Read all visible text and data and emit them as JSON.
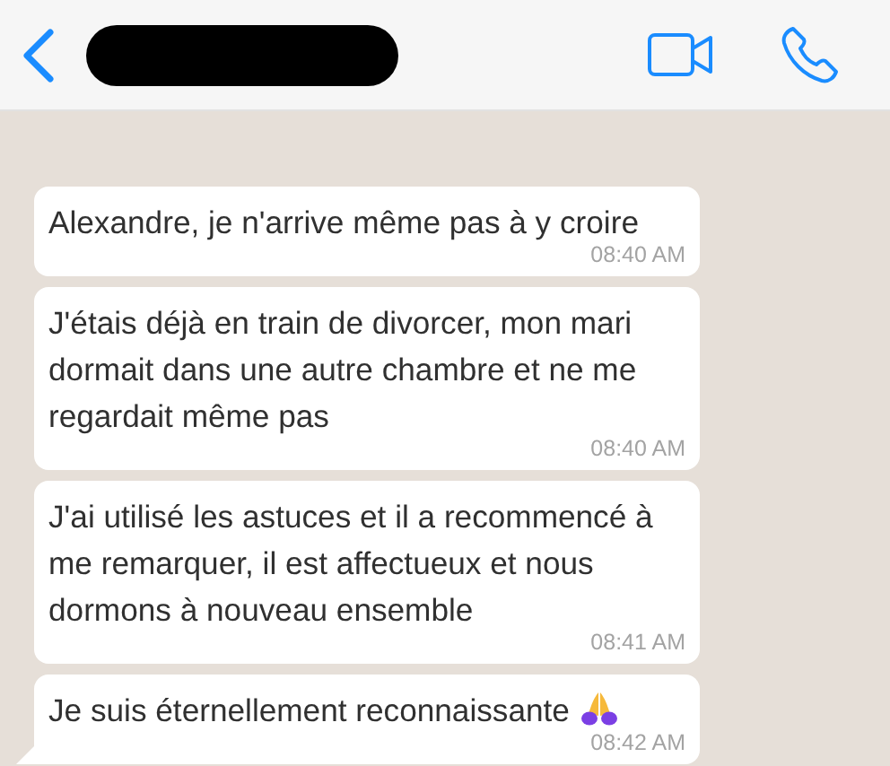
{
  "messages": [
    {
      "text": "Alexandre, je n'arrive même pas à y croire",
      "time": "08:40 AM",
      "tail": false,
      "emoji": false
    },
    {
      "text": "J'étais déjà en train de divorcer, mon mari dormait dans une autre chambre et ne me regardait même pas",
      "time": "08:40 AM",
      "tail": false,
      "emoji": false
    },
    {
      "text": "J'ai utilisé les astuces et il a recommencé à me remarquer, il est affectueux et nous dormons à nouveau ensemble",
      "time": "08:41 AM",
      "tail": false,
      "emoji": false
    },
    {
      "text": "Je suis éternellement reconnaissante",
      "time": "08:42 AM",
      "tail": true,
      "emoji": true
    }
  ]
}
